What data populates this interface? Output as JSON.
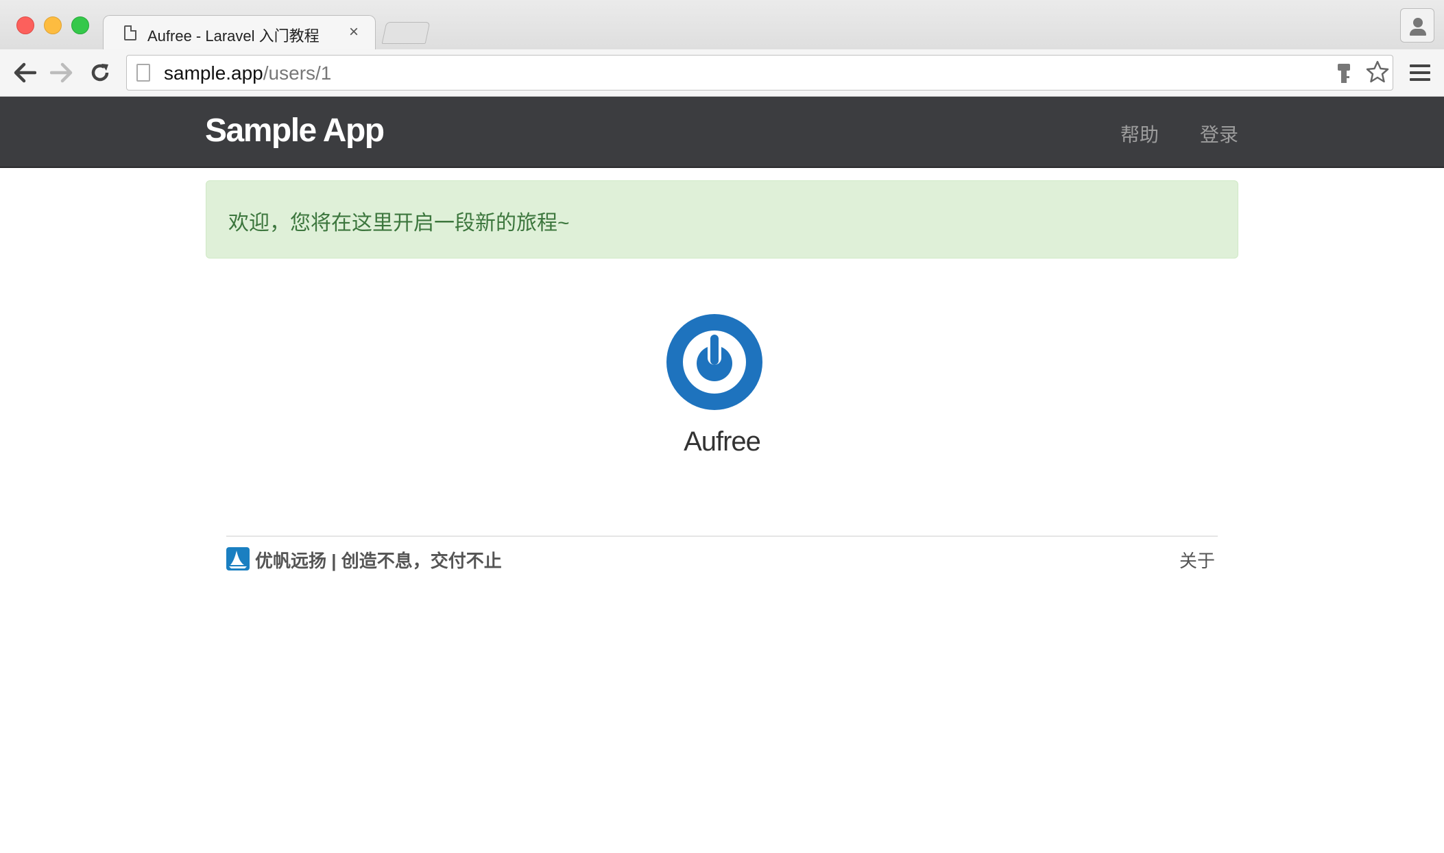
{
  "browser": {
    "tab_title": "Aufree - Laravel 入门教程",
    "tab_close": "×",
    "url_host": "sample.app",
    "url_path": "/users/1"
  },
  "navbar": {
    "brand": "Sample App",
    "links": [
      "帮助",
      "登录"
    ]
  },
  "flash": {
    "message": "欢迎，您将在这里开启一段新的旅程~"
  },
  "profile": {
    "name": "Aufree",
    "avatar_icon": "gravatar-power-icon",
    "avatar_color": "#1e73be"
  },
  "footer": {
    "slogan": "优帆远扬 | 创造不息，交付不止",
    "about": "关于",
    "logo_icon": "sailboat-logo-icon",
    "logo_color": "#1a7fc1"
  },
  "colors": {
    "navbar_bg": "#3c3d40",
    "alert_bg": "#dff0d8",
    "alert_text": "#3c763d"
  }
}
